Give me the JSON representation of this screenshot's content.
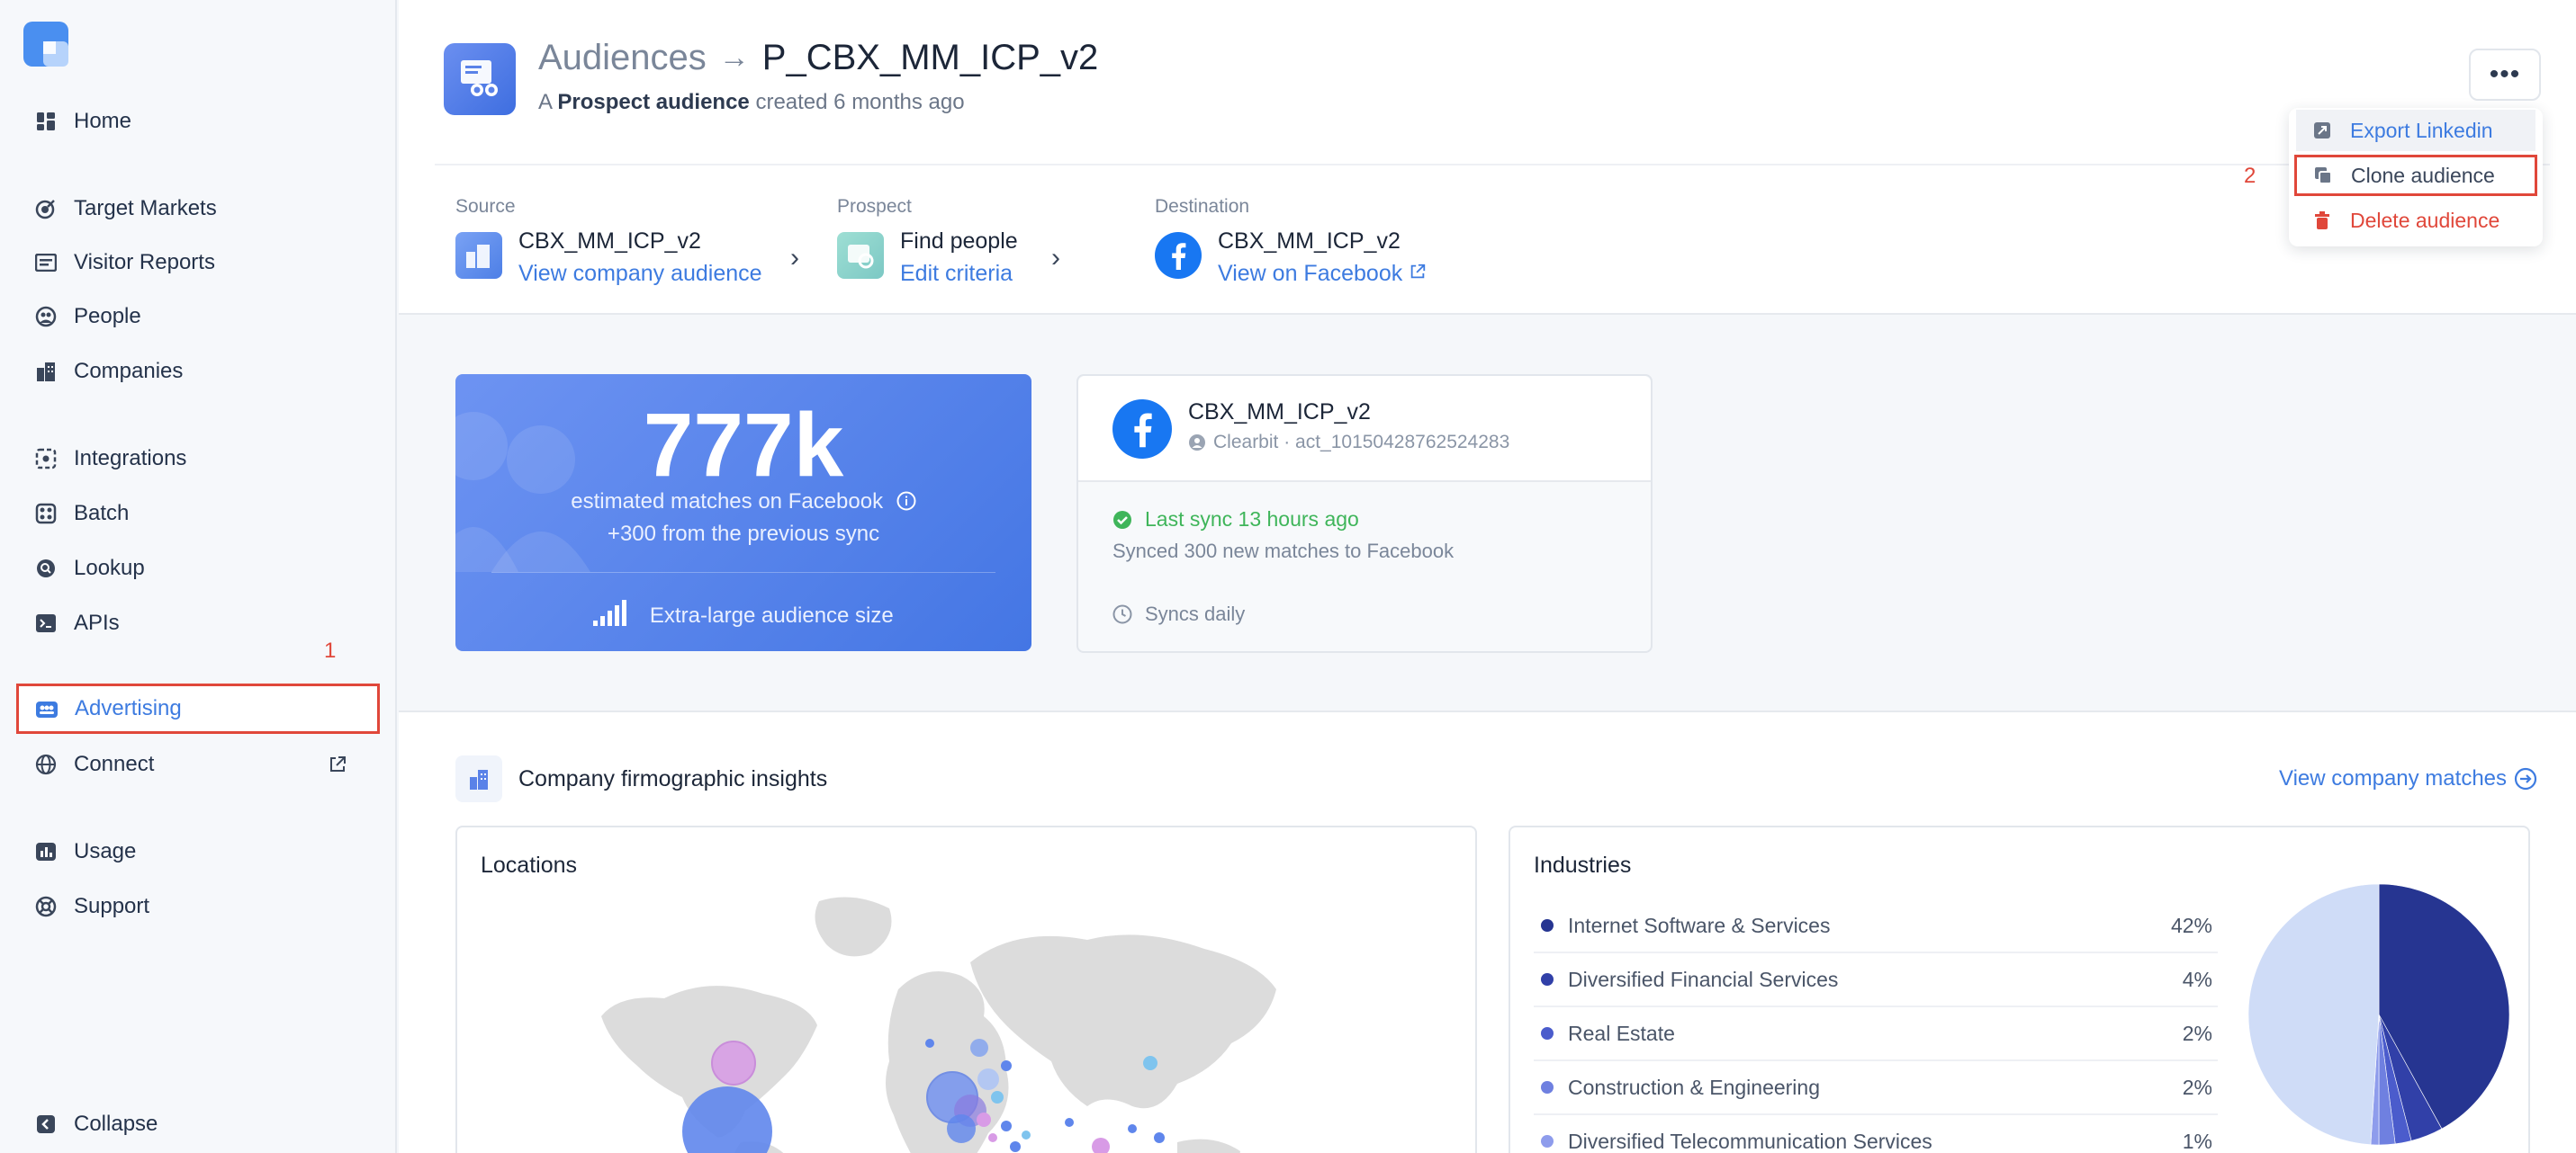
{
  "sidebar": {
    "items": [
      {
        "label": "Home",
        "icon": "dashboard-icon"
      },
      {
        "label": "Target Markets",
        "icon": "target-icon"
      },
      {
        "label": "Visitor Reports",
        "icon": "report-icon"
      },
      {
        "label": "People",
        "icon": "people-icon"
      },
      {
        "label": "Companies",
        "icon": "building-icon"
      },
      {
        "label": "Integrations",
        "icon": "integrations-icon"
      },
      {
        "label": "Batch",
        "icon": "batch-icon"
      },
      {
        "label": "Lookup",
        "icon": "lookup-icon"
      },
      {
        "label": "APIs",
        "icon": "terminal-icon"
      },
      {
        "label": "Advertising",
        "icon": "advertising-icon"
      },
      {
        "label": "Connect",
        "icon": "globe-icon"
      },
      {
        "label": "Usage",
        "icon": "usage-icon"
      },
      {
        "label": "Support",
        "icon": "lifebuoy-icon"
      }
    ],
    "collapse_label": "Collapse",
    "annotation_1": "1"
  },
  "header": {
    "breadcrumb": "Audiences",
    "title": "P_CBX_MM_ICP_v2",
    "subtitle_prefix": "A",
    "subtitle_bold": "Prospect audience",
    "subtitle_suffix": "created 6 months ago"
  },
  "flow": {
    "source": {
      "label": "Source",
      "name": "CBX_MM_ICP_v2",
      "link": "View company audience"
    },
    "prospect": {
      "label": "Prospect",
      "name": "Find people",
      "link": "Edit criteria"
    },
    "destination": {
      "label": "Destination",
      "name": "CBX_MM_ICP_v2",
      "link": "View on Facebook"
    }
  },
  "menu": {
    "more_label": "•••",
    "export": "Export Linkedin",
    "clone": "Clone audience",
    "delete": "Delete audience",
    "annotation_2": "2"
  },
  "stats": {
    "matches": "777k",
    "matches_label": "estimated matches on Facebook",
    "delta": "+300 from the previous sync",
    "size_label": "Extra-large audience size"
  },
  "sync": {
    "name": "CBX_MM_ICP_v2",
    "account": "Clearbit · act_10150428762524283",
    "last_sync": "Last sync 13 hours ago",
    "synced": "Synced 300 new matches to Facebook",
    "frequency": "Syncs daily"
  },
  "insights": {
    "title": "Company firmographic insights",
    "view_matches": "View company matches",
    "locations_title": "Locations",
    "industries_title": "Industries",
    "industries": [
      {
        "name": "Internet Software & Services",
        "pct": "42%",
        "color": "#263591"
      },
      {
        "name": "Diversified Financial Services",
        "pct": "4%",
        "color": "#3140a8"
      },
      {
        "name": "Real Estate",
        "pct": "2%",
        "color": "#4b5ccc"
      },
      {
        "name": "Construction & Engineering",
        "pct": "2%",
        "color": "#6f80e0"
      },
      {
        "name": "Diversified Telecommunication Services",
        "pct": "1%",
        "color": "#8e9cec"
      }
    ]
  },
  "colors": {
    "accent": "#3d7be0",
    "annotation": "#e0473a",
    "success": "#3fb55a"
  }
}
